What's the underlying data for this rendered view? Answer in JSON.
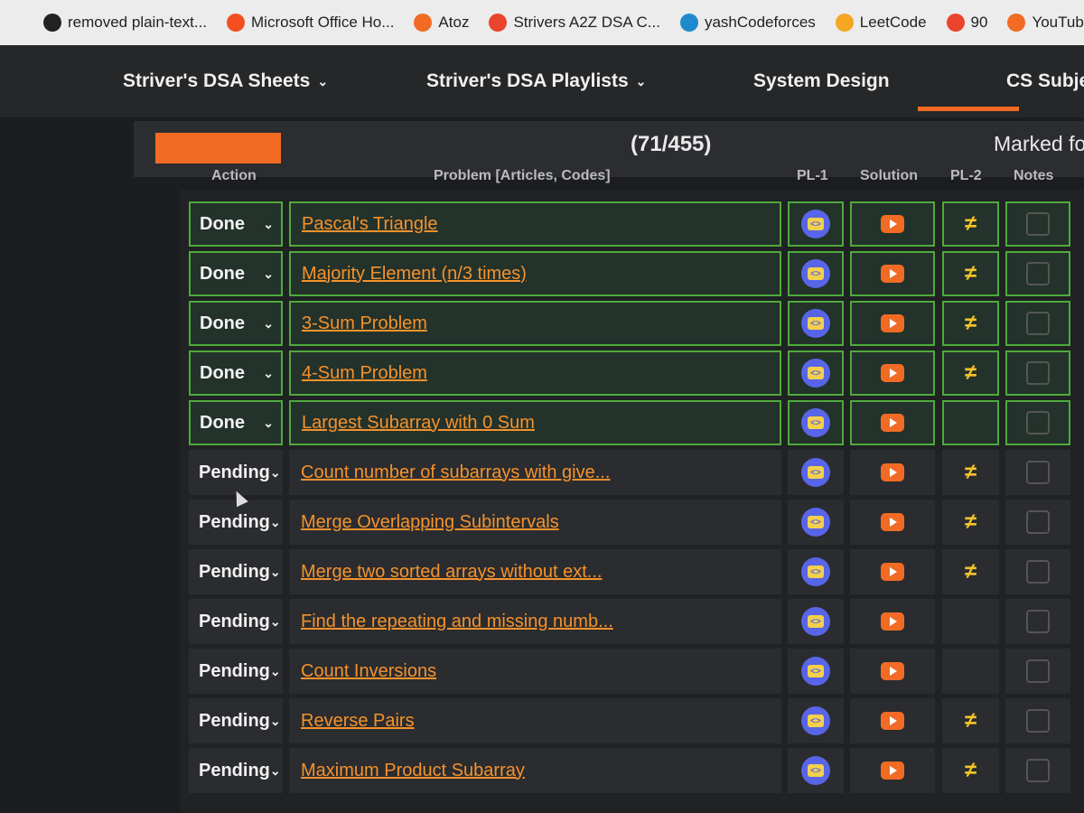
{
  "bookmarks": [
    {
      "label": "removed plain-text...",
      "icon": "github-icon",
      "color": "#222222"
    },
    {
      "label": "Microsoft Office Ho...",
      "icon": "windows-icon",
      "color": "#f25022"
    },
    {
      "label": "Atoz",
      "icon": "youtube-icon",
      "color": "#f26b24"
    },
    {
      "label": "Strivers A2Z DSA C...",
      "icon": "tuf-icon",
      "color": "#e8452c"
    },
    {
      "label": "yashCodeforces",
      "icon": "codeforces-icon",
      "color": "#1f8acb"
    },
    {
      "label": "LeetCode",
      "icon": "leetcode-icon",
      "color": "#f5a623"
    },
    {
      "label": "90",
      "icon": "tuf-icon",
      "color": "#e8452c"
    },
    {
      "label": "YouTube",
      "icon": "youtube-icon",
      "color": "#f26b24"
    }
  ],
  "nav": {
    "sheets": "Striver's DSA Sheets",
    "playlists": "Striver's DSA Playlists",
    "system_design": "System Design",
    "cs_subjects": "CS Subjec"
  },
  "progress": {
    "text": "(71/455)",
    "marked": "Marked fo"
  },
  "table": {
    "headers": {
      "action": "Action",
      "problem": "Problem [Articles, Codes]",
      "pl1": "PL-1",
      "solution": "Solution",
      "pl2": "PL-2",
      "notes": "Notes"
    },
    "rows": [
      {
        "status": "Done",
        "title": "Pascal's Triangle",
        "pl2": true
      },
      {
        "status": "Done",
        "title": "Majority Element (n/3 times)",
        "pl2": true
      },
      {
        "status": "Done",
        "title": "3-Sum Problem",
        "pl2": true
      },
      {
        "status": "Done",
        "title": "4-Sum Problem",
        "pl2": true
      },
      {
        "status": "Done",
        "title": "Largest Subarray with 0 Sum",
        "pl2": false
      },
      {
        "status": "Pending",
        "title": "Count number of subarrays with give...",
        "pl2": true
      },
      {
        "status": "Pending",
        "title": "Merge Overlapping Subintervals",
        "pl2": true
      },
      {
        "status": "Pending",
        "title": "Merge two sorted arrays without ext...",
        "pl2": true
      },
      {
        "status": "Pending",
        "title": "Find the repeating and missing numb...",
        "pl2": false
      },
      {
        "status": "Pending",
        "title": "Count Inversions",
        "pl2": false
      },
      {
        "status": "Pending",
        "title": "Reverse Pairs",
        "pl2": true
      },
      {
        "status": "Pending",
        "title": "Maximum Product Subarray",
        "pl2": true
      }
    ]
  },
  "colors": {
    "accent": "#f26b24",
    "done_border": "#4eaa3c",
    "link": "#f5922c"
  }
}
